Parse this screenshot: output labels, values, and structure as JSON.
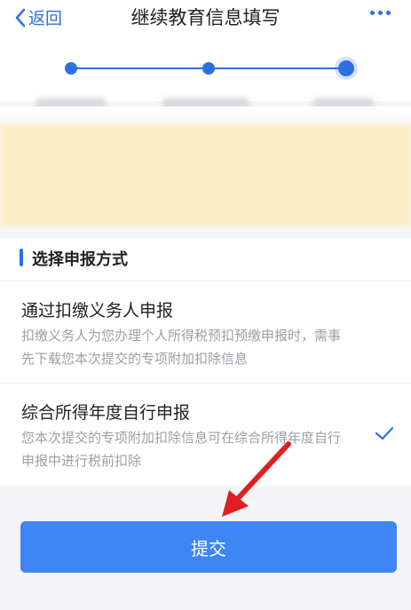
{
  "header": {
    "back_label": "返回",
    "title": "继续教育信息填写"
  },
  "steps": {
    "count": 3,
    "current": 3
  },
  "section": {
    "title": "选择申报方式"
  },
  "options": [
    {
      "title": "通过扣缴义务人申报",
      "description": "扣缴义务人为您办理个人所得税预扣预缴申报时，需事先下载您本次提交的专项附加扣除信息",
      "selected": false
    },
    {
      "title": "综合所得年度自行申报",
      "description": "您本次提交的专项附加扣除信息可在综合所得年度自行申报中进行税前扣除",
      "selected": true
    }
  ],
  "submit_label": "提交",
  "colors": {
    "accent": "#2f6fe4",
    "button": "#3d86f3",
    "annotation_arrow": "#e02020"
  },
  "icons": {
    "back": "chevron-left-icon",
    "more": "more-dots-icon",
    "selected": "checkmark-icon"
  }
}
